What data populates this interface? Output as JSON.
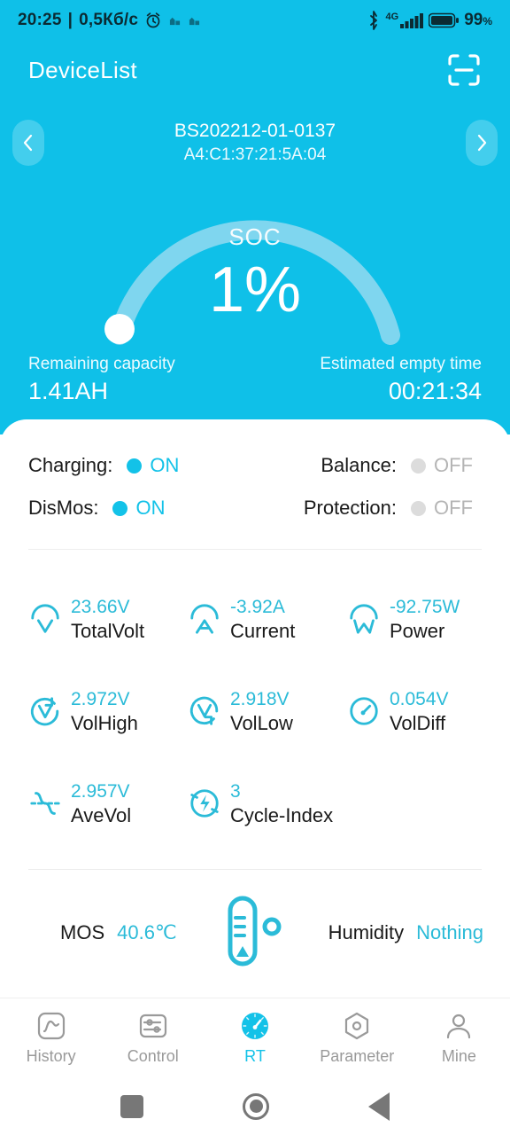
{
  "status_bar": {
    "time": "20:25",
    "separator": "|",
    "net_speed": "0,5Кб/c",
    "alarm_icon": "alarm-clock-icon",
    "app_icon_1": "app-icon",
    "app_icon_2": "app-icon",
    "bluetooth_icon": "bluetooth-icon",
    "network_type": "4G",
    "signal_icon": "signal-bars-icon",
    "battery_icon": "battery-icon",
    "battery_percent": "99",
    "battery_percent_symbol": "%"
  },
  "app_bar": {
    "title": "DeviceList",
    "scan_icon": "scan-icon"
  },
  "device": {
    "prev_icon": "chevron-left-icon",
    "next_icon": "chevron-right-icon",
    "name": "BS202212-01-0137",
    "mac": "A4:C1:37:21:5A:04"
  },
  "gauge": {
    "label": "SOC",
    "value": "1%",
    "percent": 1,
    "track_color": "#7FD6EF",
    "indicator_color": "#ffffff"
  },
  "capacity": {
    "remaining_label": "Remaining capacity",
    "remaining_value": "1.41AH",
    "empty_time_label": "Estimated empty time",
    "empty_time_value": "00:21:34"
  },
  "toggles": [
    {
      "name": "Charging:",
      "state": "ON",
      "on": true
    },
    {
      "name": "Balance:",
      "state": "OFF",
      "on": false
    },
    {
      "name": "DisMos:",
      "state": "ON",
      "on": true
    },
    {
      "name": "Protection:",
      "state": "OFF",
      "on": false
    }
  ],
  "metrics": [
    {
      "value": "23.66V",
      "label": "TotalVolt",
      "icon": "volt-meter-icon"
    },
    {
      "value": "-3.92A",
      "label": "Current",
      "icon": "ampere-meter-icon"
    },
    {
      "value": "-92.75W",
      "label": "Power",
      "icon": "watt-meter-icon"
    },
    {
      "value": "2.972V",
      "label": "VolHigh",
      "icon": "volt-high-icon"
    },
    {
      "value": "2.918V",
      "label": "VolLow",
      "icon": "volt-low-icon"
    },
    {
      "value": "0.054V",
      "label": "VolDiff",
      "icon": "volt-diff-gauge-icon"
    },
    {
      "value": "2.957V",
      "label": "AveVol",
      "icon": "average-wave-icon"
    },
    {
      "value": "3",
      "label": "Cycle-Index",
      "icon": "cycle-bolt-icon"
    }
  ],
  "temperature": {
    "thermometer_icon": "thermometer-icon",
    "mos_label": "MOS",
    "mos_value": "40.6℃",
    "humidity_label": "Humidity",
    "humidity_value": "Nothing"
  },
  "tabs": [
    {
      "label": "History",
      "icon": "chart-history-icon",
      "active": false
    },
    {
      "label": "Control",
      "icon": "sliders-icon",
      "active": false
    },
    {
      "label": "RT",
      "icon": "realtime-gauge-icon",
      "active": true
    },
    {
      "label": "Parameter",
      "icon": "hexagon-gear-icon",
      "active": false
    },
    {
      "label": "Mine",
      "icon": "user-icon",
      "active": false
    }
  ],
  "android_nav": {
    "recents_icon": "recents-square-icon",
    "home_icon": "home-circle-icon",
    "back_icon": "back-triangle-icon"
  },
  "theme": {
    "accent": "#0FC0E8",
    "metric_value": "#2BBBD8",
    "inactive": "#9a9a9a"
  }
}
